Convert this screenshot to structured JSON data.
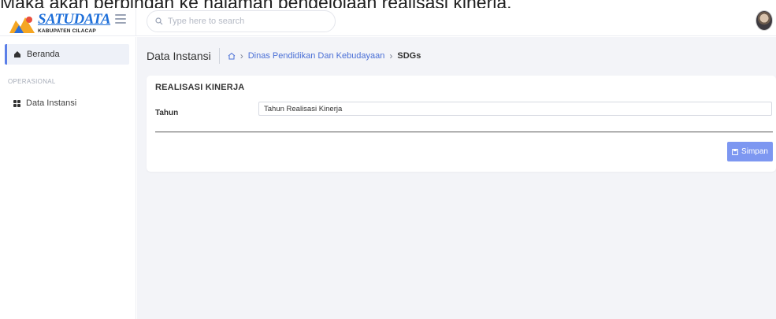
{
  "caption": "Maka akan berpindah ke halaman pengelolaan realisasi kinerja.",
  "header": {
    "logo_text": "SATUDATA",
    "logo_sub": "KABUPATEN CILACAP",
    "search_placeholder": "Type here to search"
  },
  "sidebar": {
    "active_item": "Beranda",
    "section": "OPERASIONAL",
    "items": [
      {
        "label": "Data Instansi"
      }
    ]
  },
  "breadcrumb": {
    "title": "Data Instansi",
    "link": "Dinas Pendidikan Dan Kebudayaan",
    "current": "SDGs"
  },
  "form": {
    "title": "REALISASI KINERJA",
    "year_label": "Tahun",
    "year_value": "Tahun Realisasi Kinerja",
    "save_label": "Simpan"
  },
  "colors": {
    "accent": "#5b7fe8",
    "button": "#7d97f1",
    "link": "#4a6fd6",
    "background": "#f3f4f8"
  },
  "icons": [
    "hamburger-icon",
    "search-icon",
    "home-icon",
    "grid-icon",
    "chevron-right-icon",
    "save-icon"
  ]
}
